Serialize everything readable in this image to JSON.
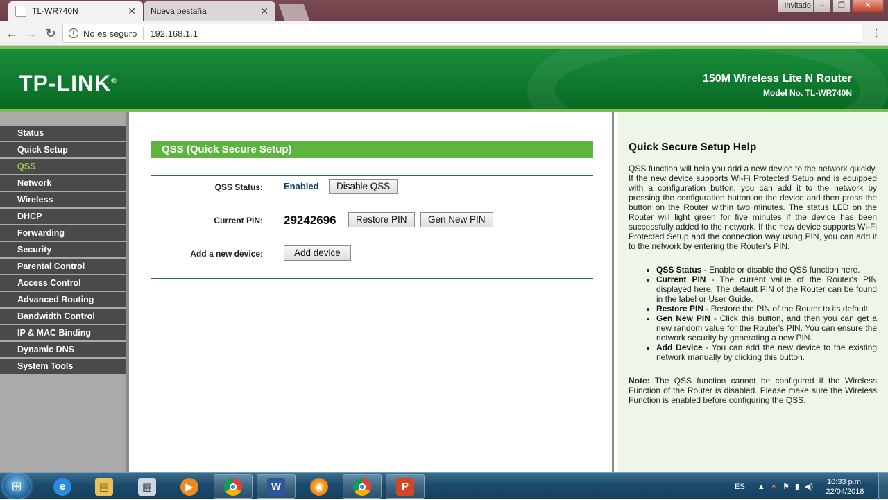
{
  "browser": {
    "tabs": [
      {
        "title": "TL-WR740N",
        "active": true
      },
      {
        "title": "Nueva pestaña",
        "active": false
      }
    ],
    "guest_label": "Invitado",
    "security_label": "No es seguro",
    "url": "192.168.1.1"
  },
  "header": {
    "logo": "TP-LINK",
    "product": "150M Wireless Lite N Router",
    "model": "Model No. TL-WR740N"
  },
  "sidebar": {
    "items": [
      {
        "label": "Status",
        "active": false
      },
      {
        "label": "Quick Setup",
        "active": false
      },
      {
        "label": "QSS",
        "active": true
      },
      {
        "label": "Network",
        "active": false
      },
      {
        "label": "Wireless",
        "active": false
      },
      {
        "label": "DHCP",
        "active": false
      },
      {
        "label": "Forwarding",
        "active": false
      },
      {
        "label": "Security",
        "active": false
      },
      {
        "label": "Parental Control",
        "active": false
      },
      {
        "label": "Access Control",
        "active": false
      },
      {
        "label": "Advanced Routing",
        "active": false
      },
      {
        "label": "Bandwidth Control",
        "active": false
      },
      {
        "label": "IP & MAC Binding",
        "active": false
      },
      {
        "label": "Dynamic DNS",
        "active": false
      },
      {
        "label": "System Tools",
        "active": false
      }
    ]
  },
  "qss": {
    "title": "QSS (Quick Secure Setup)",
    "status_label": "QSS Status:",
    "status_value": "Enabled",
    "disable_button": "Disable QSS",
    "pin_label": "Current PIN:",
    "pin_value": "29242696",
    "restore_button": "Restore PIN",
    "gen_button": "Gen New PIN",
    "add_label": "Add a new device:",
    "add_button": "Add device"
  },
  "help": {
    "title": "Quick Secure Setup Help",
    "intro": "QSS function will help you add a new device to the network quickly. If the new device supports Wi-Fi Protected Setup and is equipped with a configuration button, you can add it to the network by pressing the configuration button on the device and then press the button on the Router within two minutes. The status LED on the Router will light green for five minutes if the device has been successfully added to the network. If the new device supports Wi-Fi Protected Setup and the connection way using PIN, you can add it to the network by entering the Router's PIN.",
    "items": [
      {
        "term": "QSS Status",
        "desc": " - Enable or disable the QSS function here."
      },
      {
        "term": "Current PIN",
        "desc": " - The current value of the Router's PIN displayed here. The default PIN of the Router can be found in the label or User Guide."
      },
      {
        "term": "Restore PIN",
        "desc": " - Restore the PIN of the Router to its default."
      },
      {
        "term": "Gen New PIN",
        "desc": " - Click this button, and then you can get a new random value for the Router's PIN. You can ensure the network security by generating a new PIN."
      },
      {
        "term": "Add Device",
        "desc": " - You can add the new device to the existing network manually by clicking this button."
      }
    ],
    "note_label": "Note:",
    "note_text": " The QSS function cannot be configured if the Wireless Function of the Router is disabled. Please make sure the Wireless Function is enabled before configuring the QSS."
  },
  "taskbar": {
    "lang": "ES",
    "time": "10:33 p.m.",
    "date": "22/04/2018",
    "apps": [
      "internet-explorer",
      "file-explorer",
      "calculator",
      "media-player",
      "chrome",
      "word",
      "firefox",
      "chrome",
      "powerpoint"
    ]
  },
  "colors": {
    "header_green": "#0f7a2e",
    "title_bar_green": "#5db53f",
    "active_menu": "#9dd44a",
    "menu_bg": "#4a4a4a",
    "help_bg": "#eef5e9"
  }
}
